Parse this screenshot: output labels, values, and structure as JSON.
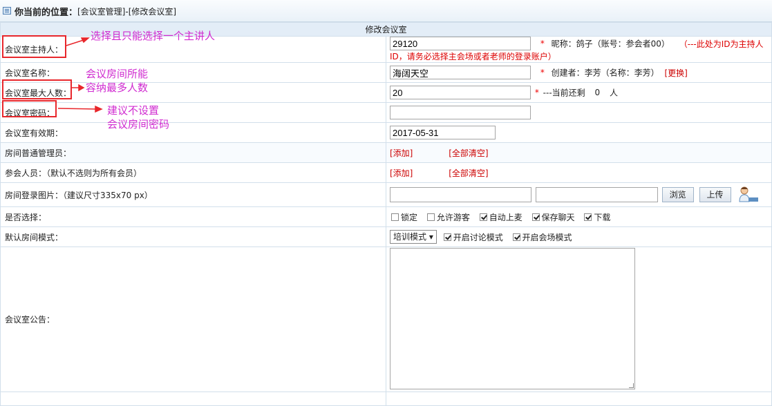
{
  "header": {
    "location_label": "你当前的位置：",
    "breadcrumb": "[会议室管理]-[修改会议室]"
  },
  "form": {
    "title": "修改会议室",
    "host": {
      "label": "会议室主持人：",
      "value": "29120",
      "required_mark": "*",
      "info": "昵称：鸽子（账号：参会者00）",
      "hint": "（---此处为ID为主持人ID，请务必选择主会场或者老师的登录账户）"
    },
    "name": {
      "label": "会议室名称：",
      "value": "海阔天空",
      "required_mark": "*",
      "creator": "创建者：李芳（名称：李芳）",
      "change_link": "[更换]"
    },
    "max_people": {
      "label": "会议室最大人数：",
      "value": "20",
      "required_mark": "*",
      "remaining_prefix": "---当前还剩",
      "remaining_value": "0",
      "remaining_unit": "人"
    },
    "password": {
      "label": "会议室密码：",
      "value": ""
    },
    "expiry": {
      "label": "会议室有效期：",
      "value": "2017-05-31"
    },
    "admins": {
      "label": "房间普通管理员：",
      "add_link": "[添加]",
      "clear_link": "[全部清空]"
    },
    "participants": {
      "label": "参会人员：（默认不选则为所有会员）",
      "add_link": "[添加]",
      "clear_link": "[全部清空]"
    },
    "login_image": {
      "label": "房间登录图片：（建议尺寸335x70 px）",
      "browse_button": "浏览",
      "upload_button": "上传",
      "icon": "person-avatar-icon"
    },
    "options": {
      "label": "是否选择：",
      "items": [
        {
          "label": "锁定",
          "checked": false
        },
        {
          "label": "允许游客",
          "checked": false
        },
        {
          "label": "自动上麦",
          "checked": true
        },
        {
          "label": "保存聊天",
          "checked": true
        },
        {
          "label": "下载",
          "checked": true
        }
      ]
    },
    "mode": {
      "label": "默认房间模式：",
      "selected": "培训模式",
      "items": [
        {
          "label": "开启讨论模式",
          "checked": true
        },
        {
          "label": "开启会场模式",
          "checked": true
        }
      ]
    },
    "notice": {
      "label": "会议室公告：",
      "value": ""
    }
  },
  "annotations": {
    "host": "选择且只能选择一个主讲人",
    "max_line1": "会议房间所能",
    "max_line2": "容纳最多人数",
    "pwd_line1": "建议不设置",
    "pwd_line2": "会议房间密码",
    "color_text": "#d02bd0",
    "color_box": "#e8262b"
  }
}
